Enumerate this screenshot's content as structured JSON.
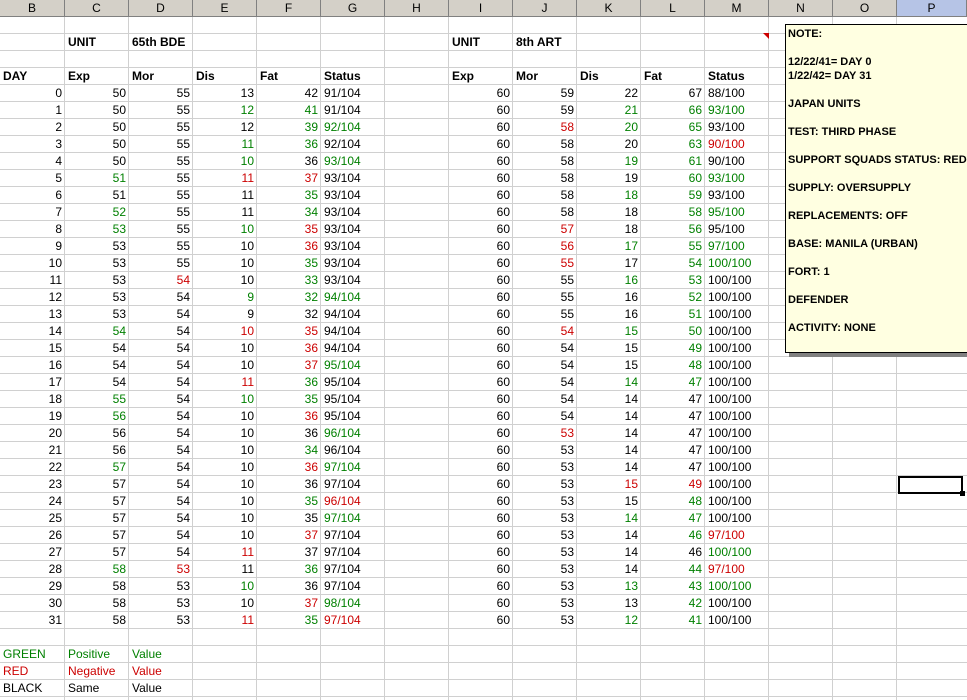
{
  "columns": [
    "B",
    "C",
    "D",
    "E",
    "F",
    "G",
    "H",
    "I",
    "J",
    "K",
    "L",
    "M",
    "N",
    "O",
    "P"
  ],
  "selected_column": "P",
  "left_unit": {
    "label": "UNIT",
    "name": "65th BDE"
  },
  "right_unit": {
    "label": "UNIT",
    "name": "8th ART"
  },
  "headers_left": [
    "DAY",
    "Exp",
    "Mor",
    "Dis",
    "Fat",
    "Status"
  ],
  "headers_right": [
    "Exp",
    "Mor",
    "Dis",
    "Fat",
    "Status"
  ],
  "rows_left": [
    [
      0,
      [
        "50",
        "k"
      ],
      [
        "55",
        "k"
      ],
      [
        "13",
        "k"
      ],
      [
        "42",
        "k"
      ],
      [
        "91/104",
        "k"
      ]
    ],
    [
      1,
      [
        "50",
        "k"
      ],
      [
        "55",
        "k"
      ],
      [
        "12",
        "g"
      ],
      [
        "41",
        "g"
      ],
      [
        "91/104",
        "k"
      ]
    ],
    [
      2,
      [
        "50",
        "k"
      ],
      [
        "55",
        "k"
      ],
      [
        "12",
        "k"
      ],
      [
        "39",
        "g"
      ],
      [
        "92/104",
        "g"
      ]
    ],
    [
      3,
      [
        "50",
        "k"
      ],
      [
        "55",
        "k"
      ],
      [
        "11",
        "g"
      ],
      [
        "36",
        "g"
      ],
      [
        "92/104",
        "k"
      ]
    ],
    [
      4,
      [
        "50",
        "k"
      ],
      [
        "55",
        "k"
      ],
      [
        "10",
        "g"
      ],
      [
        "36",
        "k"
      ],
      [
        "93/104",
        "g"
      ]
    ],
    [
      5,
      [
        "51",
        "g"
      ],
      [
        "55",
        "k"
      ],
      [
        "11",
        "rd"
      ],
      [
        "37",
        "rd"
      ],
      [
        "93/104",
        "k"
      ]
    ],
    [
      6,
      [
        "51",
        "k"
      ],
      [
        "55",
        "k"
      ],
      [
        "11",
        "k"
      ],
      [
        "35",
        "g"
      ],
      [
        "93/104",
        "k"
      ]
    ],
    [
      7,
      [
        "52",
        "g"
      ],
      [
        "55",
        "k"
      ],
      [
        "11",
        "k"
      ],
      [
        "34",
        "g"
      ],
      [
        "93/104",
        "k"
      ]
    ],
    [
      8,
      [
        "53",
        "g"
      ],
      [
        "55",
        "k"
      ],
      [
        "10",
        "g"
      ],
      [
        "35",
        "rd"
      ],
      [
        "93/104",
        "k"
      ]
    ],
    [
      9,
      [
        "53",
        "k"
      ],
      [
        "55",
        "k"
      ],
      [
        "10",
        "k"
      ],
      [
        "36",
        "rd"
      ],
      [
        "93/104",
        "k"
      ]
    ],
    [
      10,
      [
        "53",
        "k"
      ],
      [
        "55",
        "k"
      ],
      [
        "10",
        "k"
      ],
      [
        "35",
        "g"
      ],
      [
        "93/104",
        "k"
      ]
    ],
    [
      11,
      [
        "53",
        "k"
      ],
      [
        "54",
        "rd"
      ],
      [
        "10",
        "k"
      ],
      [
        "33",
        "g"
      ],
      [
        "93/104",
        "k"
      ]
    ],
    [
      12,
      [
        "53",
        "k"
      ],
      [
        "54",
        "k"
      ],
      [
        "9",
        "g"
      ],
      [
        "32",
        "g"
      ],
      [
        "94/104",
        "g"
      ]
    ],
    [
      13,
      [
        "53",
        "k"
      ],
      [
        "54",
        "k"
      ],
      [
        "9",
        "k"
      ],
      [
        "32",
        "k"
      ],
      [
        "94/104",
        "k"
      ]
    ],
    [
      14,
      [
        "54",
        "g"
      ],
      [
        "54",
        "k"
      ],
      [
        "10",
        "rd"
      ],
      [
        "35",
        "rd"
      ],
      [
        "94/104",
        "k"
      ]
    ],
    [
      15,
      [
        "54",
        "k"
      ],
      [
        "54",
        "k"
      ],
      [
        "10",
        "k"
      ],
      [
        "36",
        "rd"
      ],
      [
        "94/104",
        "k"
      ]
    ],
    [
      16,
      [
        "54",
        "k"
      ],
      [
        "54",
        "k"
      ],
      [
        "10",
        "k"
      ],
      [
        "37",
        "rd"
      ],
      [
        "95/104",
        "g"
      ]
    ],
    [
      17,
      [
        "54",
        "k"
      ],
      [
        "54",
        "k"
      ],
      [
        "11",
        "rd"
      ],
      [
        "36",
        "g"
      ],
      [
        "95/104",
        "k"
      ]
    ],
    [
      18,
      [
        "55",
        "g"
      ],
      [
        "54",
        "k"
      ],
      [
        "10",
        "g"
      ],
      [
        "35",
        "g"
      ],
      [
        "95/104",
        "k"
      ]
    ],
    [
      19,
      [
        "56",
        "g"
      ],
      [
        "54",
        "k"
      ],
      [
        "10",
        "k"
      ],
      [
        "36",
        "rd"
      ],
      [
        "95/104",
        "k"
      ]
    ],
    [
      20,
      [
        "56",
        "k"
      ],
      [
        "54",
        "k"
      ],
      [
        "10",
        "k"
      ],
      [
        "36",
        "k"
      ],
      [
        "96/104",
        "g"
      ]
    ],
    [
      21,
      [
        "56",
        "k"
      ],
      [
        "54",
        "k"
      ],
      [
        "10",
        "k"
      ],
      [
        "34",
        "g"
      ],
      [
        "96/104",
        "k"
      ]
    ],
    [
      22,
      [
        "57",
        "g"
      ],
      [
        "54",
        "k"
      ],
      [
        "10",
        "k"
      ],
      [
        "36",
        "rd"
      ],
      [
        "97/104",
        "g"
      ]
    ],
    [
      23,
      [
        "57",
        "k"
      ],
      [
        "54",
        "k"
      ],
      [
        "10",
        "k"
      ],
      [
        "36",
        "k"
      ],
      [
        "97/104",
        "k"
      ]
    ],
    [
      24,
      [
        "57",
        "k"
      ],
      [
        "54",
        "k"
      ],
      [
        "10",
        "k"
      ],
      [
        "35",
        "g"
      ],
      [
        "96/104",
        "rd"
      ]
    ],
    [
      25,
      [
        "57",
        "k"
      ],
      [
        "54",
        "k"
      ],
      [
        "10",
        "k"
      ],
      [
        "35",
        "k"
      ],
      [
        "97/104",
        "g"
      ]
    ],
    [
      26,
      [
        "57",
        "k"
      ],
      [
        "54",
        "k"
      ],
      [
        "10",
        "k"
      ],
      [
        "37",
        "rd"
      ],
      [
        "97/104",
        "k"
      ]
    ],
    [
      27,
      [
        "57",
        "k"
      ],
      [
        "54",
        "k"
      ],
      [
        "11",
        "rd"
      ],
      [
        "37",
        "k"
      ],
      [
        "97/104",
        "k"
      ]
    ],
    [
      28,
      [
        "58",
        "g"
      ],
      [
        "53",
        "rd"
      ],
      [
        "11",
        "k"
      ],
      [
        "36",
        "g"
      ],
      [
        "97/104",
        "k"
      ]
    ],
    [
      29,
      [
        "58",
        "k"
      ],
      [
        "53",
        "k"
      ],
      [
        "10",
        "g"
      ],
      [
        "36",
        "k"
      ],
      [
        "97/104",
        "k"
      ]
    ],
    [
      30,
      [
        "58",
        "k"
      ],
      [
        "53",
        "k"
      ],
      [
        "10",
        "k"
      ],
      [
        "37",
        "rd"
      ],
      [
        "98/104",
        "g"
      ]
    ],
    [
      31,
      [
        "58",
        "k"
      ],
      [
        "53",
        "k"
      ],
      [
        "11",
        "rd"
      ],
      [
        "35",
        "g"
      ],
      [
        "97/104",
        "rd"
      ]
    ]
  ],
  "rows_right": [
    [
      [
        "60",
        "k"
      ],
      [
        "59",
        "k"
      ],
      [
        "22",
        "k"
      ],
      [
        "67",
        "k"
      ],
      [
        "88/100",
        "k"
      ]
    ],
    [
      [
        "60",
        "k"
      ],
      [
        "59",
        "k"
      ],
      [
        "21",
        "g"
      ],
      [
        "66",
        "g"
      ],
      [
        "93/100",
        "g"
      ]
    ],
    [
      [
        "60",
        "k"
      ],
      [
        "58",
        "rd"
      ],
      [
        "20",
        "g"
      ],
      [
        "65",
        "g"
      ],
      [
        "93/100",
        "k"
      ]
    ],
    [
      [
        "60",
        "k"
      ],
      [
        "58",
        "k"
      ],
      [
        "20",
        "k"
      ],
      [
        "63",
        "g"
      ],
      [
        "90/100",
        "rd"
      ]
    ],
    [
      [
        "60",
        "k"
      ],
      [
        "58",
        "k"
      ],
      [
        "19",
        "g"
      ],
      [
        "61",
        "g"
      ],
      [
        "90/100",
        "k"
      ]
    ],
    [
      [
        "60",
        "k"
      ],
      [
        "58",
        "k"
      ],
      [
        "19",
        "k"
      ],
      [
        "60",
        "g"
      ],
      [
        "93/100",
        "g"
      ]
    ],
    [
      [
        "60",
        "k"
      ],
      [
        "58",
        "k"
      ],
      [
        "18",
        "g"
      ],
      [
        "59",
        "g"
      ],
      [
        "93/100",
        "k"
      ]
    ],
    [
      [
        "60",
        "k"
      ],
      [
        "58",
        "k"
      ],
      [
        "18",
        "k"
      ],
      [
        "58",
        "g"
      ],
      [
        "95/100",
        "g"
      ]
    ],
    [
      [
        "60",
        "k"
      ],
      [
        "57",
        "rd"
      ],
      [
        "18",
        "k"
      ],
      [
        "56",
        "g"
      ],
      [
        "95/100",
        "k"
      ]
    ],
    [
      [
        "60",
        "k"
      ],
      [
        "56",
        "rd"
      ],
      [
        "17",
        "g"
      ],
      [
        "55",
        "g"
      ],
      [
        "97/100",
        "g"
      ]
    ],
    [
      [
        "60",
        "k"
      ],
      [
        "55",
        "rd"
      ],
      [
        "17",
        "k"
      ],
      [
        "54",
        "g"
      ],
      [
        "100/100",
        "g"
      ]
    ],
    [
      [
        "60",
        "k"
      ],
      [
        "55",
        "k"
      ],
      [
        "16",
        "g"
      ],
      [
        "53",
        "g"
      ],
      [
        "100/100",
        "k"
      ]
    ],
    [
      [
        "60",
        "k"
      ],
      [
        "55",
        "k"
      ],
      [
        "16",
        "k"
      ],
      [
        "52",
        "g"
      ],
      [
        "100/100",
        "k"
      ]
    ],
    [
      [
        "60",
        "k"
      ],
      [
        "55",
        "k"
      ],
      [
        "16",
        "k"
      ],
      [
        "51",
        "g"
      ],
      [
        "100/100",
        "k"
      ]
    ],
    [
      [
        "60",
        "k"
      ],
      [
        "54",
        "rd"
      ],
      [
        "15",
        "g"
      ],
      [
        "50",
        "g"
      ],
      [
        "100/100",
        "k"
      ]
    ],
    [
      [
        "60",
        "k"
      ],
      [
        "54",
        "k"
      ],
      [
        "15",
        "k"
      ],
      [
        "49",
        "g"
      ],
      [
        "100/100",
        "k"
      ]
    ],
    [
      [
        "60",
        "k"
      ],
      [
        "54",
        "k"
      ],
      [
        "15",
        "k"
      ],
      [
        "48",
        "g"
      ],
      [
        "100/100",
        "k"
      ]
    ],
    [
      [
        "60",
        "k"
      ],
      [
        "54",
        "k"
      ],
      [
        "14",
        "g"
      ],
      [
        "47",
        "g"
      ],
      [
        "100/100",
        "k"
      ]
    ],
    [
      [
        "60",
        "k"
      ],
      [
        "54",
        "k"
      ],
      [
        "14",
        "k"
      ],
      [
        "47",
        "k"
      ],
      [
        "100/100",
        "k"
      ]
    ],
    [
      [
        "60",
        "k"
      ],
      [
        "54",
        "k"
      ],
      [
        "14",
        "k"
      ],
      [
        "47",
        "k"
      ],
      [
        "100/100",
        "k"
      ]
    ],
    [
      [
        "60",
        "k"
      ],
      [
        "53",
        "rd"
      ],
      [
        "14",
        "k"
      ],
      [
        "47",
        "k"
      ],
      [
        "100/100",
        "k"
      ]
    ],
    [
      [
        "60",
        "k"
      ],
      [
        "53",
        "k"
      ],
      [
        "14",
        "k"
      ],
      [
        "47",
        "k"
      ],
      [
        "100/100",
        "k"
      ]
    ],
    [
      [
        "60",
        "k"
      ],
      [
        "53",
        "k"
      ],
      [
        "14",
        "k"
      ],
      [
        "47",
        "k"
      ],
      [
        "100/100",
        "k"
      ]
    ],
    [
      [
        "60",
        "k"
      ],
      [
        "53",
        "k"
      ],
      [
        "15",
        "rd"
      ],
      [
        "49",
        "rd"
      ],
      [
        "100/100",
        "k"
      ]
    ],
    [
      [
        "60",
        "k"
      ],
      [
        "53",
        "k"
      ],
      [
        "15",
        "k"
      ],
      [
        "48",
        "g"
      ],
      [
        "100/100",
        "k"
      ]
    ],
    [
      [
        "60",
        "k"
      ],
      [
        "53",
        "k"
      ],
      [
        "14",
        "g"
      ],
      [
        "47",
        "g"
      ],
      [
        "100/100",
        "k"
      ]
    ],
    [
      [
        "60",
        "k"
      ],
      [
        "53",
        "k"
      ],
      [
        "14",
        "k"
      ],
      [
        "46",
        "g"
      ],
      [
        "97/100",
        "rd"
      ]
    ],
    [
      [
        "60",
        "k"
      ],
      [
        "53",
        "k"
      ],
      [
        "14",
        "k"
      ],
      [
        "46",
        "k"
      ],
      [
        "100/100",
        "g"
      ]
    ],
    [
      [
        "60",
        "k"
      ],
      [
        "53",
        "k"
      ],
      [
        "14",
        "k"
      ],
      [
        "44",
        "g"
      ],
      [
        "97/100",
        "rd"
      ]
    ],
    [
      [
        "60",
        "k"
      ],
      [
        "53",
        "k"
      ],
      [
        "13",
        "g"
      ],
      [
        "43",
        "g"
      ],
      [
        "100/100",
        "g"
      ]
    ],
    [
      [
        "60",
        "k"
      ],
      [
        "53",
        "k"
      ],
      [
        "13",
        "k"
      ],
      [
        "42",
        "g"
      ],
      [
        "100/100",
        "k"
      ]
    ],
    [
      [
        "60",
        "k"
      ],
      [
        "53",
        "k"
      ],
      [
        "12",
        "g"
      ],
      [
        "41",
        "g"
      ],
      [
        "100/100",
        "k"
      ]
    ]
  ],
  "legend": [
    [
      "GREEN",
      "Positive",
      "Value",
      "g"
    ],
    [
      "RED",
      "Negative",
      "Value",
      "rd"
    ],
    [
      "BLACK",
      "Same",
      "Value",
      "k"
    ]
  ],
  "note": [
    "NOTE:",
    "",
    "12/22/41= DAY 0",
    "1/22/42= DAY 31",
    "",
    "JAPAN UNITS",
    "",
    "TEST: THIRD PHASE",
    "",
    "SUPPORT SQUADS STATUS: RED",
    "",
    "SUPPLY: OVERSUPPLY",
    "",
    "REPLACEMENTS: OFF",
    "",
    "BASE: MANILA (URBAN)",
    "",
    "FORT: 1",
    "",
    "DEFENDER",
    "",
    "ACTIVITY: NONE"
  ],
  "colors": {
    "green": "#008000",
    "red": "#cc0000",
    "black": "#000000",
    "note_bg": "#ffffe1",
    "header_bg": "#d4d0c8"
  }
}
